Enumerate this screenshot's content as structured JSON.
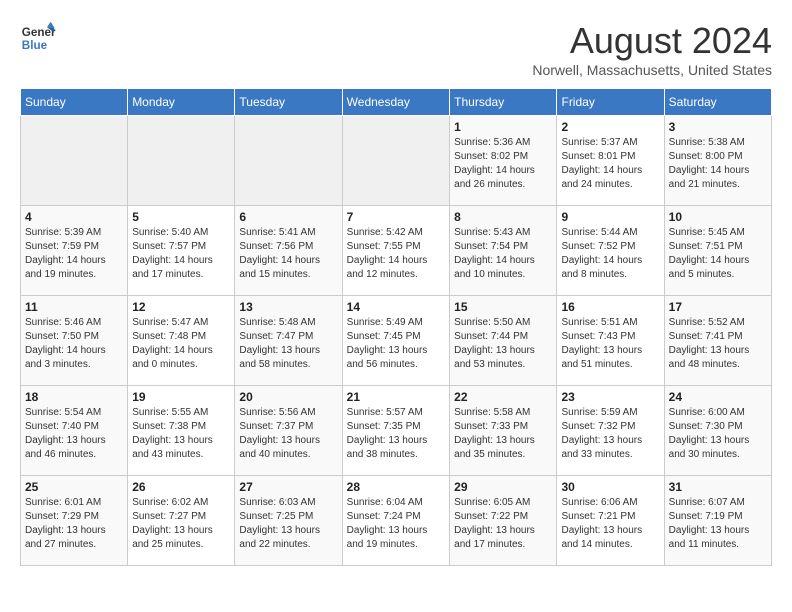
{
  "header": {
    "logo_line1": "General",
    "logo_line2": "Blue",
    "title": "August 2024",
    "subtitle": "Norwell, Massachusetts, United States"
  },
  "weekdays": [
    "Sunday",
    "Monday",
    "Tuesday",
    "Wednesday",
    "Thursday",
    "Friday",
    "Saturday"
  ],
  "weeks": [
    [
      {
        "day": "",
        "info": ""
      },
      {
        "day": "",
        "info": ""
      },
      {
        "day": "",
        "info": ""
      },
      {
        "day": "",
        "info": ""
      },
      {
        "day": "1",
        "info": "Sunrise: 5:36 AM\nSunset: 8:02 PM\nDaylight: 14 hours\nand 26 minutes."
      },
      {
        "day": "2",
        "info": "Sunrise: 5:37 AM\nSunset: 8:01 PM\nDaylight: 14 hours\nand 24 minutes."
      },
      {
        "day": "3",
        "info": "Sunrise: 5:38 AM\nSunset: 8:00 PM\nDaylight: 14 hours\nand 21 minutes."
      }
    ],
    [
      {
        "day": "4",
        "info": "Sunrise: 5:39 AM\nSunset: 7:59 PM\nDaylight: 14 hours\nand 19 minutes."
      },
      {
        "day": "5",
        "info": "Sunrise: 5:40 AM\nSunset: 7:57 PM\nDaylight: 14 hours\nand 17 minutes."
      },
      {
        "day": "6",
        "info": "Sunrise: 5:41 AM\nSunset: 7:56 PM\nDaylight: 14 hours\nand 15 minutes."
      },
      {
        "day": "7",
        "info": "Sunrise: 5:42 AM\nSunset: 7:55 PM\nDaylight: 14 hours\nand 12 minutes."
      },
      {
        "day": "8",
        "info": "Sunrise: 5:43 AM\nSunset: 7:54 PM\nDaylight: 14 hours\nand 10 minutes."
      },
      {
        "day": "9",
        "info": "Sunrise: 5:44 AM\nSunset: 7:52 PM\nDaylight: 14 hours\nand 8 minutes."
      },
      {
        "day": "10",
        "info": "Sunrise: 5:45 AM\nSunset: 7:51 PM\nDaylight: 14 hours\nand 5 minutes."
      }
    ],
    [
      {
        "day": "11",
        "info": "Sunrise: 5:46 AM\nSunset: 7:50 PM\nDaylight: 14 hours\nand 3 minutes."
      },
      {
        "day": "12",
        "info": "Sunrise: 5:47 AM\nSunset: 7:48 PM\nDaylight: 14 hours\nand 0 minutes."
      },
      {
        "day": "13",
        "info": "Sunrise: 5:48 AM\nSunset: 7:47 PM\nDaylight: 13 hours\nand 58 minutes."
      },
      {
        "day": "14",
        "info": "Sunrise: 5:49 AM\nSunset: 7:45 PM\nDaylight: 13 hours\nand 56 minutes."
      },
      {
        "day": "15",
        "info": "Sunrise: 5:50 AM\nSunset: 7:44 PM\nDaylight: 13 hours\nand 53 minutes."
      },
      {
        "day": "16",
        "info": "Sunrise: 5:51 AM\nSunset: 7:43 PM\nDaylight: 13 hours\nand 51 minutes."
      },
      {
        "day": "17",
        "info": "Sunrise: 5:52 AM\nSunset: 7:41 PM\nDaylight: 13 hours\nand 48 minutes."
      }
    ],
    [
      {
        "day": "18",
        "info": "Sunrise: 5:54 AM\nSunset: 7:40 PM\nDaylight: 13 hours\nand 46 minutes."
      },
      {
        "day": "19",
        "info": "Sunrise: 5:55 AM\nSunset: 7:38 PM\nDaylight: 13 hours\nand 43 minutes."
      },
      {
        "day": "20",
        "info": "Sunrise: 5:56 AM\nSunset: 7:37 PM\nDaylight: 13 hours\nand 40 minutes."
      },
      {
        "day": "21",
        "info": "Sunrise: 5:57 AM\nSunset: 7:35 PM\nDaylight: 13 hours\nand 38 minutes."
      },
      {
        "day": "22",
        "info": "Sunrise: 5:58 AM\nSunset: 7:33 PM\nDaylight: 13 hours\nand 35 minutes."
      },
      {
        "day": "23",
        "info": "Sunrise: 5:59 AM\nSunset: 7:32 PM\nDaylight: 13 hours\nand 33 minutes."
      },
      {
        "day": "24",
        "info": "Sunrise: 6:00 AM\nSunset: 7:30 PM\nDaylight: 13 hours\nand 30 minutes."
      }
    ],
    [
      {
        "day": "25",
        "info": "Sunrise: 6:01 AM\nSunset: 7:29 PM\nDaylight: 13 hours\nand 27 minutes."
      },
      {
        "day": "26",
        "info": "Sunrise: 6:02 AM\nSunset: 7:27 PM\nDaylight: 13 hours\nand 25 minutes."
      },
      {
        "day": "27",
        "info": "Sunrise: 6:03 AM\nSunset: 7:25 PM\nDaylight: 13 hours\nand 22 minutes."
      },
      {
        "day": "28",
        "info": "Sunrise: 6:04 AM\nSunset: 7:24 PM\nDaylight: 13 hours\nand 19 minutes."
      },
      {
        "day": "29",
        "info": "Sunrise: 6:05 AM\nSunset: 7:22 PM\nDaylight: 13 hours\nand 17 minutes."
      },
      {
        "day": "30",
        "info": "Sunrise: 6:06 AM\nSunset: 7:21 PM\nDaylight: 13 hours\nand 14 minutes."
      },
      {
        "day": "31",
        "info": "Sunrise: 6:07 AM\nSunset: 7:19 PM\nDaylight: 13 hours\nand 11 minutes."
      }
    ]
  ]
}
